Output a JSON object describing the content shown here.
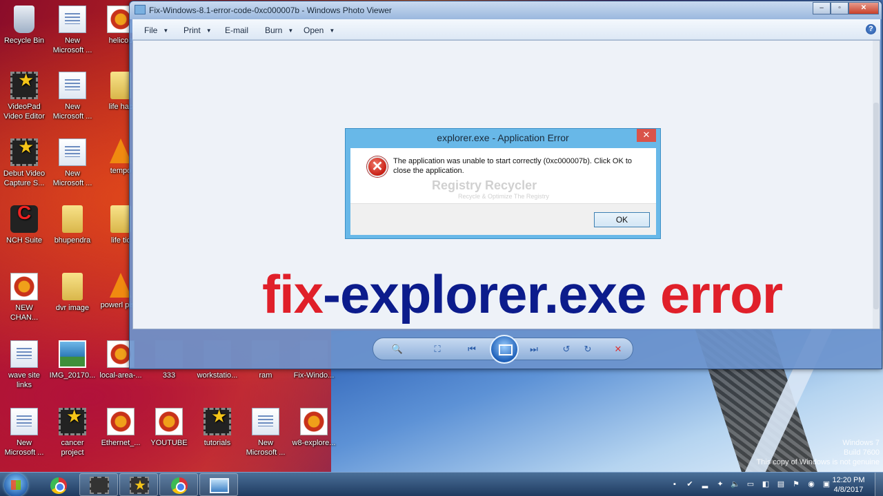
{
  "desktop": {
    "icons": [
      {
        "label": "Recycle Bin"
      },
      {
        "label": "New Microsoft ..."
      },
      {
        "label": "helicop"
      },
      {
        "label": "VideoPad Video Editor"
      },
      {
        "label": "New Microsoft ..."
      },
      {
        "label": "life hac"
      },
      {
        "label": "Debut Video Capture S..."
      },
      {
        "label": "New Microsoft ..."
      },
      {
        "label": "tempo"
      },
      {
        "label": "NCH Suite"
      },
      {
        "label": "bhupendra"
      },
      {
        "label": "life tic"
      },
      {
        "label": "NEW CHAN..."
      },
      {
        "label": "dvr image"
      },
      {
        "label": "powerl pisto"
      },
      {
        "label": "wave site links"
      },
      {
        "label": "IMG_20170..."
      },
      {
        "label": "local-area-..."
      },
      {
        "label": "333"
      },
      {
        "label": "workstatio..."
      },
      {
        "label": "ram"
      },
      {
        "label": "Fix-Windo..."
      },
      {
        "label": "New Microsoft ..."
      },
      {
        "label": "cancer project"
      },
      {
        "label": "Ethernet_..."
      },
      {
        "label": "YOUTUBE"
      },
      {
        "label": "tutorials"
      },
      {
        "label": "New Microsoft ..."
      },
      {
        "label": "w8-explore..."
      }
    ],
    "genuine_notice": [
      "Windows 7",
      "Build 7600",
      "This copy of Windows is not genuine"
    ]
  },
  "window": {
    "title": "Fix-Windows-8.1-error-code-0xc000007b - Windows Photo Viewer",
    "buttons": {
      "minimize": "–",
      "maximize": "▫",
      "close": "✕"
    },
    "menu": [
      "File",
      "Print",
      "E-mail",
      "Burn",
      "Open"
    ],
    "help": "?"
  },
  "dialog": {
    "title": "explorer.exe - Application Error",
    "close": "✕",
    "message": "The application was unable to start correctly (0xc000007b). Click OK to close the application.",
    "watermark": "Registry Recycler",
    "watermark_sub": "Recycle & Optimize The Registry",
    "ok_label": "OK"
  },
  "caption": {
    "part1": "fix",
    "part2": "-explorer.exe ",
    "part3": "error"
  },
  "taskbar": {
    "clock_time": "12:20 PM",
    "clock_date": "4/8/2017"
  },
  "colors": {
    "caption_red": "#e0202a",
    "caption_blue": "#0c1c8c",
    "dialog_frame": "#68b8e8"
  }
}
